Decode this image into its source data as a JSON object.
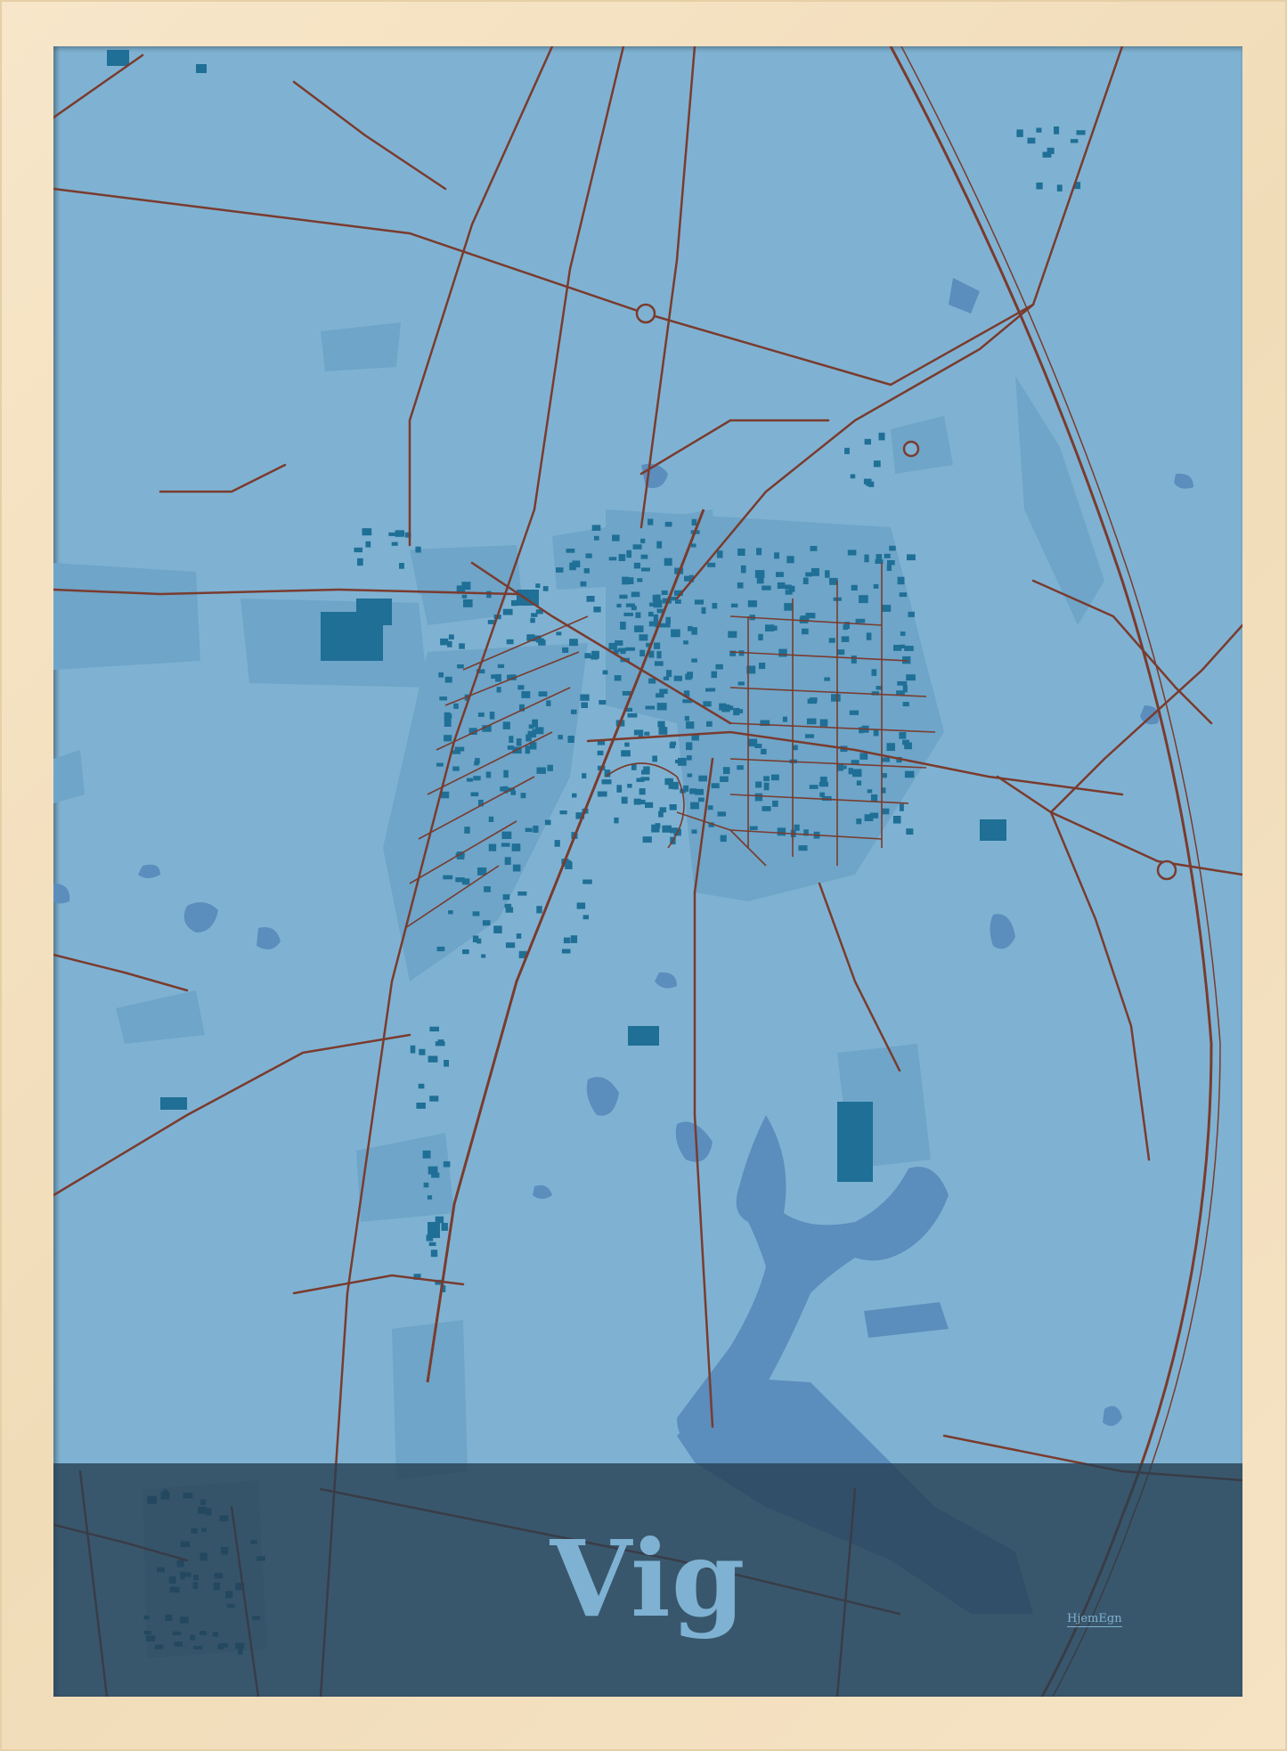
{
  "poster": {
    "title": "Vig",
    "brand": "HjemEgn"
  },
  "colors": {
    "frame": "#f4e1c1",
    "land": "#7fb2d2",
    "urban": "#6ea5c8",
    "water": "#5b8dbd",
    "buildings": "#1f6f96",
    "roads": "#7a3b2e",
    "banner": "#253e50",
    "title_text": "#7fb2d2"
  },
  "map_features": [
    "roads",
    "railway",
    "buildings",
    "lakes",
    "wetlands",
    "roundabouts"
  ]
}
